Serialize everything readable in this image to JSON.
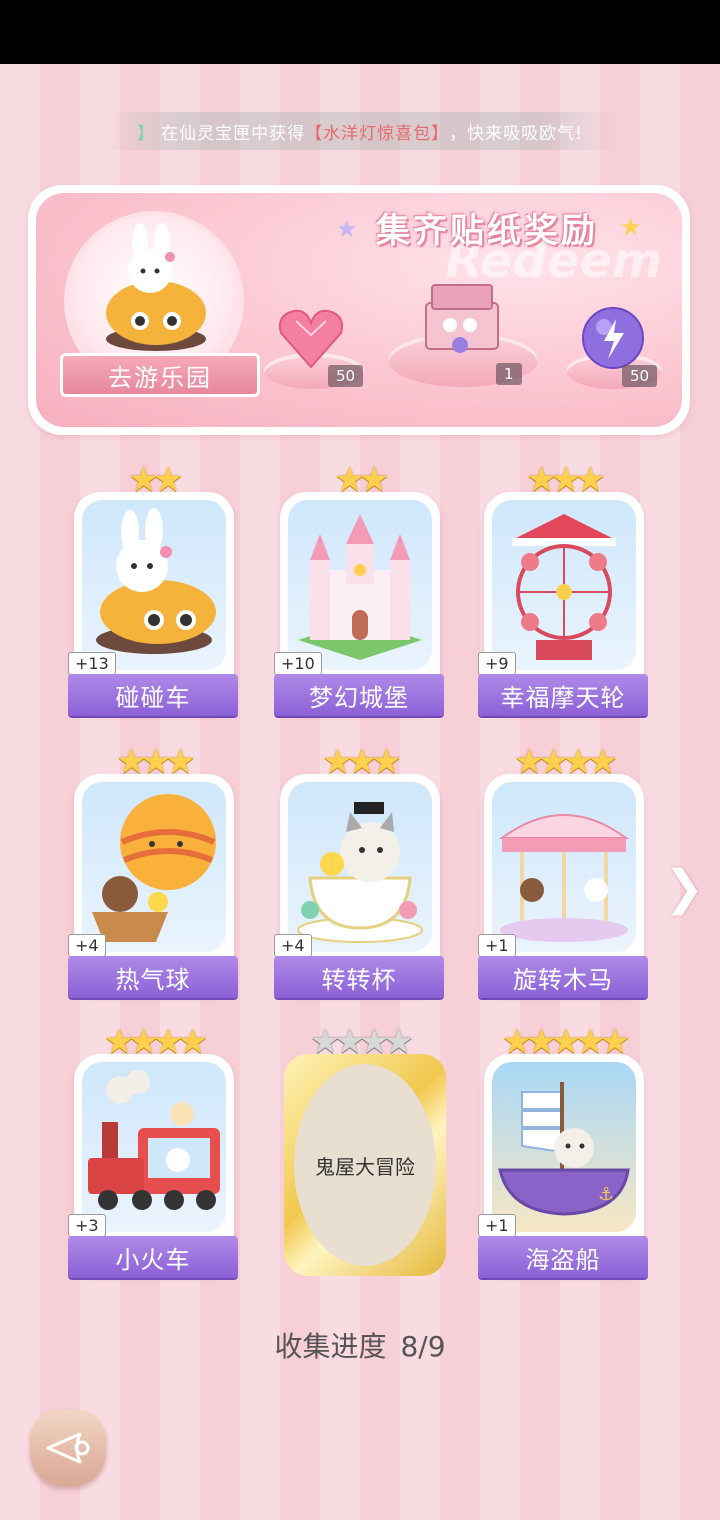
{
  "ticker": {
    "bracket": "】",
    "prefix": "在仙灵宝匣中获得",
    "item": "【水洋灯惊喜包】",
    "suffix": "，快来吸吸欧气!"
  },
  "banner": {
    "title": "集齐贴纸奖励",
    "watermark": "Redeem",
    "goto_label": "去游乐园",
    "rewards": [
      {
        "icon": "pink-heart-gem-icon",
        "count": "50"
      },
      {
        "icon": "gift-box-icon",
        "count": "1"
      },
      {
        "icon": "purple-energy-orb-icon",
        "count": "50"
      }
    ]
  },
  "cards": [
    {
      "name": "碰碰车",
      "count": "+13",
      "stars": "★★",
      "stars_value": 2,
      "icon": "bumper-car-bunny-icon"
    },
    {
      "name": "梦幻城堡",
      "count": "+10",
      "stars": "★★",
      "stars_value": 2,
      "icon": "castle-icon"
    },
    {
      "name": "幸福摩天轮",
      "count": "+9",
      "stars": "★★★",
      "stars_value": 3,
      "icon": "ferris-wheel-icon"
    },
    {
      "name": "热气球",
      "count": "+4",
      "stars": "★★★",
      "stars_value": 3,
      "icon": "hot-air-balloon-icon"
    },
    {
      "name": "转转杯",
      "count": "+4",
      "stars": "★★★",
      "stars_value": 3,
      "icon": "teacup-cat-icon"
    },
    {
      "name": "旋转木马",
      "count": "+1",
      "stars": "★★★★",
      "stars_value": 4,
      "icon": "carousel-icon"
    },
    {
      "name": "小火车",
      "count": "+3",
      "stars": "★★★★",
      "stars_value": 4,
      "icon": "train-icon"
    },
    {
      "name": "鬼屋大冒险",
      "count": "",
      "stars": "★★★★",
      "stars_value": 4,
      "icon": "locked-card",
      "locked": true
    },
    {
      "name": "海盗船",
      "count": "+1",
      "stars": "★★★★★",
      "stars_value": 5,
      "icon": "pirate-ship-icon"
    }
  ],
  "progress": {
    "label": "收集进度",
    "value": "8/9"
  },
  "nav": {
    "next_icon": "chevron-right-icon",
    "back_icon": "back-arrow-icon"
  }
}
